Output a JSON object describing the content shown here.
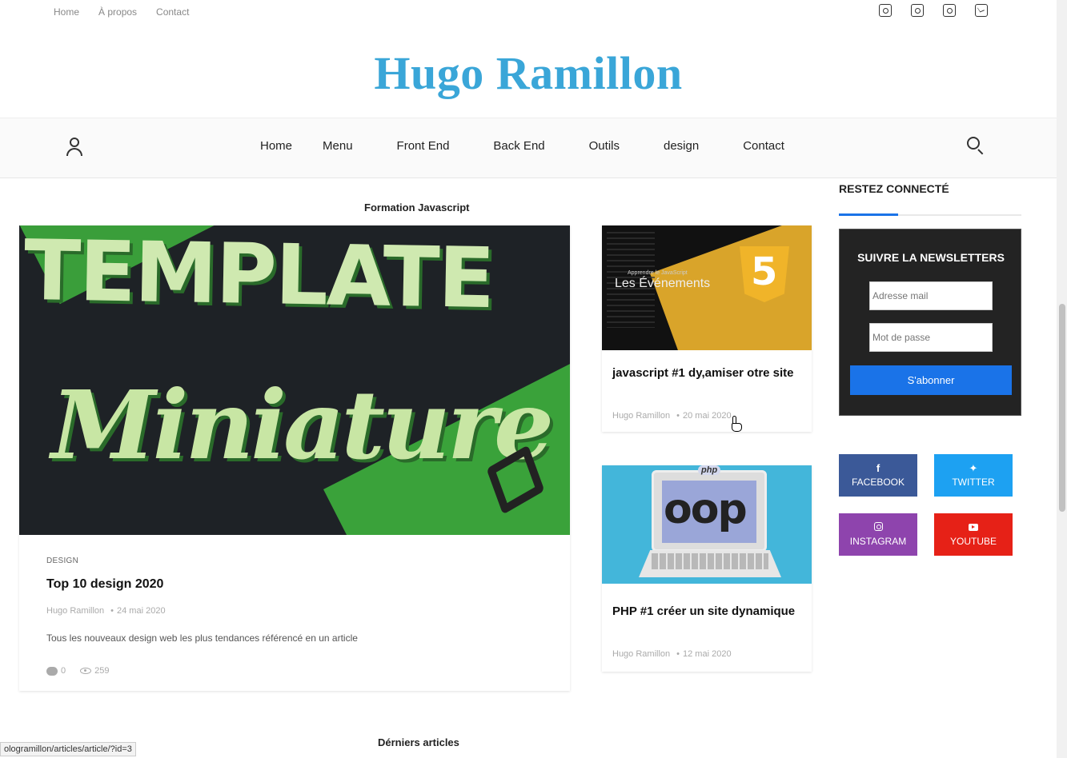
{
  "topbar": {
    "links": [
      "Home",
      "À propos",
      "Contact"
    ],
    "social_icons": [
      "instagram-icon",
      "twitter-icon",
      "youtube-icon",
      "mail-icon"
    ]
  },
  "brand": {
    "title": "Hugo Ramillon",
    "color": "#3aa6d8"
  },
  "nav": {
    "items": [
      "Home",
      "Menu",
      "Front End",
      "Back End",
      "Outils",
      "design",
      "Contact"
    ]
  },
  "main": {
    "section_title": "Formation Javascript",
    "featured": {
      "image_text_top": "TEMPLATE",
      "image_text_bottom": "Miniature",
      "category": "DESIGN",
      "title": "Top 10 design 2020",
      "author": "Hugo Ramillon",
      "date": "24 mai 2020",
      "excerpt": "Tous les nouveaux design web les plus tendances référencé en un article",
      "comments": "0",
      "views": "259"
    },
    "cards": [
      {
        "image_small": "Apprendre le JavaScript",
        "image_text": "Les Événements",
        "image_badge": "5",
        "title": "javascript #1 dy,amiser otre site",
        "author": "Hugo Ramillon",
        "date": "20 mai 2020"
      },
      {
        "image_badge": "php",
        "image_text": "oop",
        "title": "PHP #1 créer un site dynamique",
        "author": "Hugo Ramillon",
        "date": "12 mai 2020"
      }
    ],
    "bottom_title": "Dérniers articles"
  },
  "sidebar": {
    "widget_title": "RESTEZ CONNECTÉ",
    "newsletter": {
      "title": "SUIVRE LA NEWSLETTERS",
      "email_placeholder": "Adresse mail",
      "password_placeholder": "Mot de passe",
      "button": "S'abonner"
    },
    "social": [
      {
        "label": "FACEBOOK",
        "glyph": "f",
        "color": "#3b5998"
      },
      {
        "label": "TWITTER",
        "glyph": "",
        "color": "#1da1f2"
      },
      {
        "label": "INSTAGRAM",
        "glyph": "",
        "color": "#8e44ad"
      },
      {
        "label": "YOUTUBE",
        "glyph": "",
        "color": "#e62117"
      }
    ],
    "accent_color": "#1a73e8"
  },
  "statusbar": {
    "url": "ologramillon/articles/article/?id=3"
  }
}
